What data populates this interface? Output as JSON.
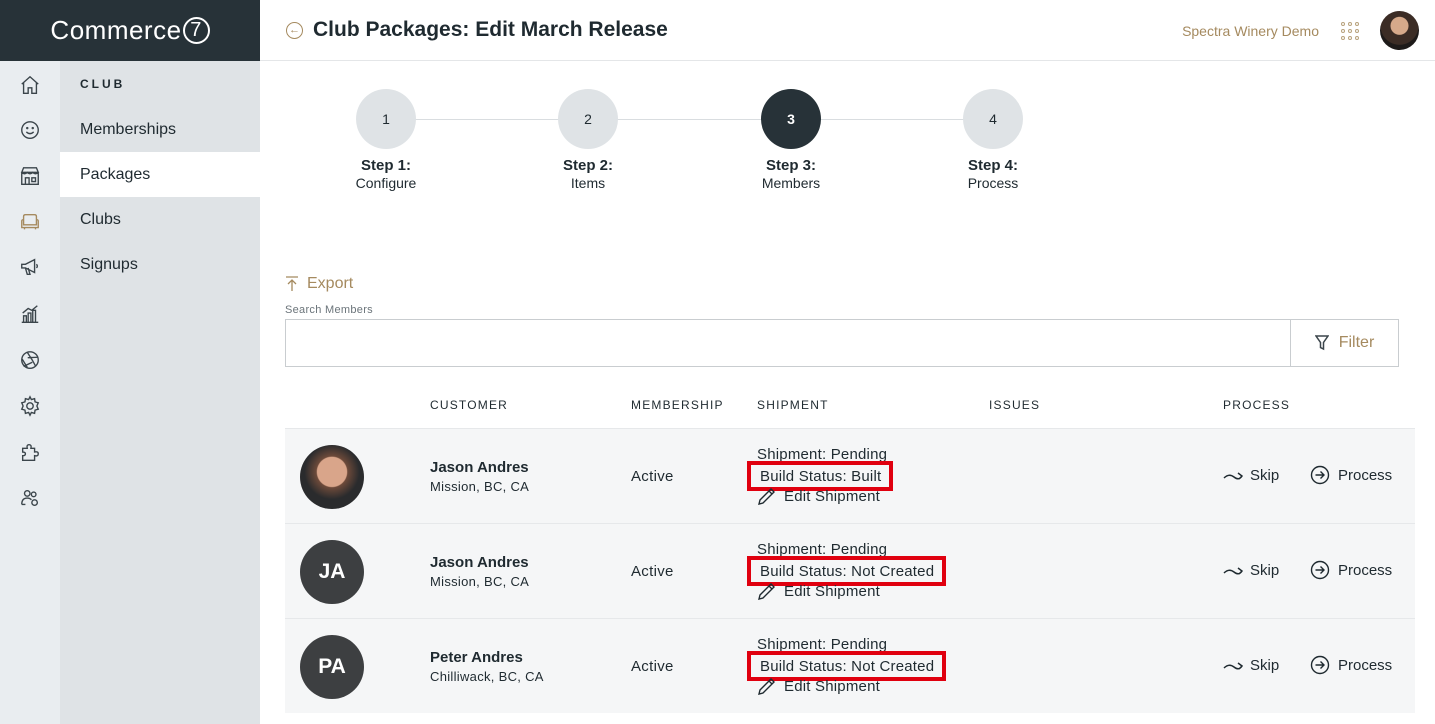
{
  "brand": {
    "name": "Commerce",
    "mark": "7"
  },
  "header": {
    "title_prefix": "Club Packages:",
    "title_main": "Edit March Release",
    "account_name": "Spectra Winery Demo"
  },
  "rail": {
    "items": [
      {
        "icon": "home-icon"
      },
      {
        "icon": "smiley-icon"
      },
      {
        "icon": "store-icon"
      },
      {
        "icon": "club-couch-icon",
        "active": true
      },
      {
        "icon": "megaphone-icon"
      },
      {
        "icon": "reports-icon"
      },
      {
        "icon": "aperture-icon"
      },
      {
        "icon": "gear-icon"
      },
      {
        "icon": "puzzle-icon"
      },
      {
        "icon": "users-settings-icon"
      }
    ]
  },
  "subnav": {
    "heading": "CLUB",
    "items": [
      {
        "label": "Memberships"
      },
      {
        "label": "Packages",
        "active": true
      },
      {
        "label": "Clubs"
      },
      {
        "label": "Signups"
      }
    ]
  },
  "steps": [
    {
      "number": "1",
      "title": "Step 1:",
      "sub": "Configure"
    },
    {
      "number": "2",
      "title": "Step 2:",
      "sub": "Items"
    },
    {
      "number": "3",
      "title": "Step 3:",
      "sub": "Members",
      "current": true
    },
    {
      "number": "4",
      "title": "Step 4:",
      "sub": "Process"
    }
  ],
  "toolbar": {
    "export_label": "Export",
    "search_label": "Search Members",
    "search_value": "",
    "filter_label": "Filter"
  },
  "table": {
    "headers": {
      "customer": "CUSTOMER",
      "membership": "MEMBERSHIP",
      "shipment": "SHIPMENT",
      "issues": "ISSUES",
      "process": "PROCESS"
    },
    "rows": [
      {
        "avatar_initials": "",
        "name": "Jason Andres",
        "location": "Mission, BC, CA",
        "membership": "Active",
        "shipment_status": "Shipment: Pending",
        "build_status": "Build Status: Built",
        "edit_label": "Edit Shipment",
        "issues": "",
        "skip_label": "Skip",
        "process_label": "Process"
      },
      {
        "avatar_initials": "JA",
        "name": "Jason Andres",
        "location": "Mission, BC, CA",
        "membership": "Active",
        "shipment_status": "Shipment: Pending",
        "build_status": "Build Status: Not Created",
        "edit_label": "Edit Shipment",
        "issues": "",
        "skip_label": "Skip",
        "process_label": "Process"
      },
      {
        "avatar_initials": "PA",
        "name": "Peter Andres",
        "location": "Chilliwack, BC, CA",
        "membership": "Active",
        "shipment_status": "Shipment: Pending",
        "build_status": "Build Status: Not Created",
        "edit_label": "Edit Shipment",
        "issues": "",
        "skip_label": "Skip",
        "process_label": "Process"
      }
    ]
  },
  "colors": {
    "brand_dark": "#273238",
    "accent_gold": "#a58a5f",
    "highlight_red": "#e0000f",
    "rail_bg": "#e9edf0",
    "subnav_bg": "#dfe3e6"
  }
}
